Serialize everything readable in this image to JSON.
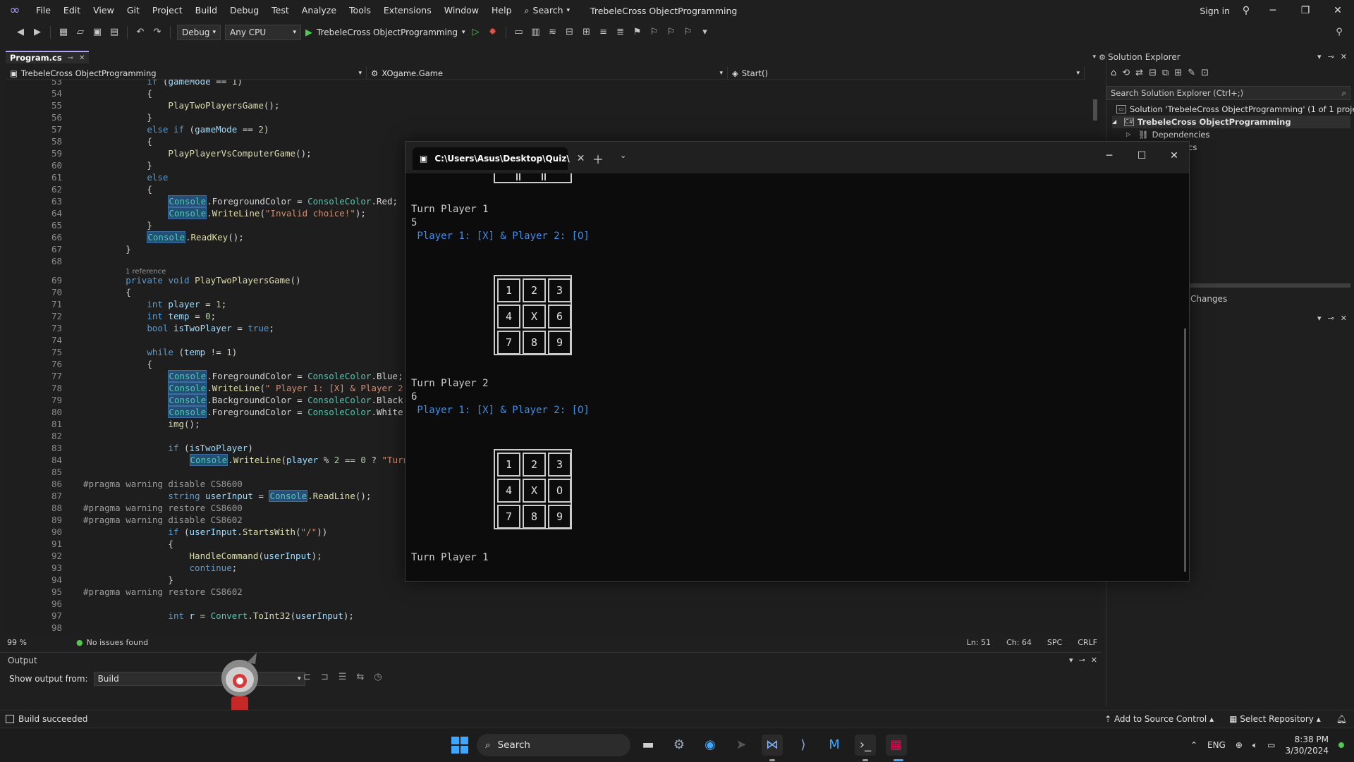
{
  "titlebar": {
    "menu": [
      "File",
      "Edit",
      "View",
      "Git",
      "Project",
      "Build",
      "Debug",
      "Test",
      "Analyze",
      "Tools",
      "Extensions",
      "Window",
      "Help"
    ],
    "search_label": "Search",
    "solution_name": "TrebeleCross ObjectProgramming",
    "sign_in": "Sign in"
  },
  "toolbar": {
    "config": "Debug",
    "platform": "Any CPU",
    "run_target": "TrebeleCross ObjectProgramming"
  },
  "editor": {
    "tab_label": "Program.cs",
    "nav_project": "TrebeleCross ObjectProgramming",
    "nav_class": "XOgame.Game",
    "nav_member": "Start()",
    "reference_hint": "1 reference",
    "lines": [
      {
        "n": "53",
        "text": "            if (gameMode == 1)"
      },
      {
        "n": "54",
        "text": "            {"
      },
      {
        "n": "55",
        "text": "                PlayTwoPlayersGame();"
      },
      {
        "n": "56",
        "text": "            }"
      },
      {
        "n": "57",
        "text": "            else if (gameMode == 2)"
      },
      {
        "n": "58",
        "text": "            {"
      },
      {
        "n": "59",
        "text": "                PlayPlayerVsComputerGame();"
      },
      {
        "n": "60",
        "text": "            }"
      },
      {
        "n": "61",
        "text": "            else"
      },
      {
        "n": "62",
        "text": "            {"
      },
      {
        "n": "63",
        "text": "                Console.ForegroundColor = ConsoleColor.Red;"
      },
      {
        "n": "64",
        "text": "                Console.WriteLine(\"Invalid choice!\");"
      },
      {
        "n": "65",
        "text": "            }"
      },
      {
        "n": "66",
        "text": "            Console.ReadKey();"
      },
      {
        "n": "67",
        "text": "        }"
      },
      {
        "n": "68",
        "text": ""
      },
      {
        "n": "69",
        "text": "        private void PlayTwoPlayersGame()"
      },
      {
        "n": "70",
        "text": "        {"
      },
      {
        "n": "71",
        "text": "            int player = 1;"
      },
      {
        "n": "72",
        "text": "            int temp = 0;"
      },
      {
        "n": "73",
        "text": "            bool isTwoPlayer = true;"
      },
      {
        "n": "74",
        "text": ""
      },
      {
        "n": "75",
        "text": "            while (temp != 1)"
      },
      {
        "n": "76",
        "text": "            {"
      },
      {
        "n": "77",
        "text": "                Console.ForegroundColor = ConsoleColor.Blue;"
      },
      {
        "n": "78",
        "text": "                Console.WriteLine(\" Player 1: [X] & Player 2"
      },
      {
        "n": "79",
        "text": "                Console.BackgroundColor = ConsoleColor.Black"
      },
      {
        "n": "80",
        "text": "                Console.ForegroundColor = ConsoleColor.White"
      },
      {
        "n": "81",
        "text": "                img();"
      },
      {
        "n": "82",
        "text": ""
      },
      {
        "n": "83",
        "text": "                if (isTwoPlayer)"
      },
      {
        "n": "84",
        "text": "                    Console.WriteLine(player % 2 == 0 ? \"Turn"
      },
      {
        "n": "85",
        "text": ""
      },
      {
        "n": "86",
        "text": "#pragma warning disable CS8600"
      },
      {
        "n": "87",
        "text": "                string userInput = Console.ReadLine();"
      },
      {
        "n": "88",
        "text": "#pragma warning restore CS8600"
      },
      {
        "n": "89",
        "text": "#pragma warning disable CS8602"
      },
      {
        "n": "90",
        "text": "                if (userInput.StartsWith(\"/\"))"
      },
      {
        "n": "91",
        "text": "                {"
      },
      {
        "n": "92",
        "text": "                    HandleCommand(userInput);"
      },
      {
        "n": "93",
        "text": "                    continue;"
      },
      {
        "n": "94",
        "text": "                }"
      },
      {
        "n": "95",
        "text": "#pragma warning restore CS8602"
      },
      {
        "n": "96",
        "text": ""
      },
      {
        "n": "97",
        "text": "                int r = Convert.ToInt32(userInput);"
      },
      {
        "n": "98",
        "text": ""
      }
    ]
  },
  "editor_status": {
    "zoom": "99 %",
    "issues": "No issues found",
    "ln": "Ln: 51",
    "ch": "Ch: 64",
    "spc": "SPC",
    "crlf": "CRLF"
  },
  "output": {
    "title": "Output",
    "from_label": "Show output from:",
    "from_value": "Build"
  },
  "solution_explorer": {
    "title": "Solution Explorer",
    "search_placeholder": "Search Solution Explorer (Ctrl+;)",
    "solution_node": "Solution 'TrebeleCross ObjectProgramming' (1 of 1 project)",
    "project_node": "TrebeleCross ObjectProgramming",
    "dependencies_node": "Dependencies",
    "partial_file": "cs",
    "git_changes": "Changes"
  },
  "console": {
    "tab_title": "C:\\Users\\Asus\\Desktop\\Quiz\\",
    "lines": [
      "Turn Player 1",
      "5",
      " Player 1: [X] & Player 2: [O]",
      "Turn Player 2",
      "6",
      " Player 1: [X] & Player 2: [O]",
      "Turn Player 1"
    ],
    "board1": [
      "1",
      "2",
      "3",
      "4",
      "X",
      "6",
      "7",
      "8",
      "9"
    ],
    "board2": [
      "1",
      "2",
      "3",
      "4",
      "X",
      "O",
      "7",
      "8",
      "9"
    ]
  },
  "statusbar": {
    "build": "Build succeeded",
    "source_control": "Add to Source Control",
    "repository": "Select Repository"
  },
  "taskbar": {
    "search": "Search",
    "language": "ENG",
    "time": "8:38 PM",
    "date": "3/30/2024"
  },
  "colors": {
    "accent": "#b4a0ff",
    "console_blue": "#3b8eea",
    "success": "#4ec94e"
  }
}
